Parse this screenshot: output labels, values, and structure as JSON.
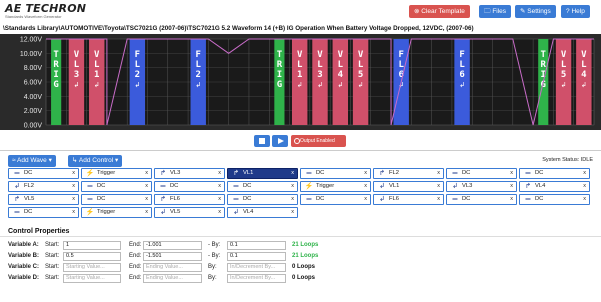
{
  "logo": {
    "main": "AE TECHRON",
    "sub": "Standards Waveform Generator"
  },
  "toolbar": {
    "clear_label": "Clear Template",
    "files_label": "Files",
    "settings_label": "Settings",
    "help_label": "Help"
  },
  "path": "\\Standards Library\\AUTOMOTIVE\\Toyota\\TSC7021G (2007-06)\\TSC7021G 5.2 Waveform 14 (+B) IG Operation When Battery Voltage Dropped, 12VDC, (2007-06)",
  "chart_data": {
    "type": "line",
    "y_ticks": [
      "12.00V",
      "10.00V",
      "8.00V",
      "6.00V",
      "4.00V",
      "2.00V",
      "0.00V"
    ],
    "ylim": [
      0,
      12
    ],
    "background": "#2a2a2a",
    "segments": [
      {
        "label": "TRIG",
        "kind": "trigger",
        "color": "#2fb34a"
      },
      {
        "label": "VL3",
        "kind": "vl",
        "color": "#d0506a"
      },
      {
        "label": "VL1",
        "kind": "vl",
        "color": "#d0506a"
      },
      {
        "label": "",
        "kind": "dc",
        "color": ""
      },
      {
        "label": "FL2",
        "kind": "fl",
        "color": "#3b5bdb"
      },
      {
        "label": "",
        "kind": "dc",
        "color": ""
      },
      {
        "label": "",
        "kind": "dc",
        "color": ""
      },
      {
        "label": "FL2",
        "kind": "fl",
        "color": "#3b5bdb"
      },
      {
        "label": "",
        "kind": "dc",
        "color": ""
      },
      {
        "label": "",
        "kind": "dc",
        "color": ""
      },
      {
        "label": "",
        "kind": "dc",
        "color": ""
      },
      {
        "label": "TRIG",
        "kind": "trigger",
        "color": "#2fb34a"
      },
      {
        "label": "VL1",
        "kind": "vl",
        "color": "#d0506a"
      },
      {
        "label": "VL3",
        "kind": "vl",
        "color": "#d0506a"
      },
      {
        "label": "VL4",
        "kind": "vl",
        "color": "#d0506a"
      },
      {
        "label": "VL5",
        "kind": "vl",
        "color": "#d0506a"
      },
      {
        "label": "",
        "kind": "dc",
        "color": ""
      },
      {
        "label": "FL6",
        "kind": "fl",
        "color": "#3b5bdb"
      },
      {
        "label": "",
        "kind": "dc",
        "color": ""
      },
      {
        "label": "",
        "kind": "dc",
        "color": ""
      },
      {
        "label": "FL6",
        "kind": "fl",
        "color": "#3b5bdb"
      },
      {
        "label": "",
        "kind": "dc",
        "color": ""
      },
      {
        "label": "",
        "kind": "dc",
        "color": ""
      },
      {
        "label": "",
        "kind": "dc",
        "color": ""
      },
      {
        "label": "TRIG",
        "kind": "trigger",
        "color": "#2fb34a"
      },
      {
        "label": "VL5",
        "kind": "vl",
        "color": "#d0506a"
      },
      {
        "label": "VL4",
        "kind": "vl",
        "color": "#d0506a"
      }
    ]
  },
  "transport": {
    "output_label": "Output Enabled"
  },
  "controls": {
    "add_wave_label": "Add Wave",
    "add_control_label": "Add Control",
    "status_label": "System Status:",
    "status_value": "IDLE"
  },
  "tiles": [
    {
      "label": "DC",
      "icon": "dc-icon",
      "selected": false
    },
    {
      "label": "Trigger",
      "icon": "trigger-icon",
      "selected": false
    },
    {
      "label": "VL3",
      "icon": "loop-icon",
      "selected": false
    },
    {
      "label": "VL1",
      "icon": "loop-icon",
      "selected": true
    },
    {
      "label": "DC",
      "icon": "dc-icon",
      "selected": false
    },
    {
      "label": "FL2",
      "icon": "loop-icon",
      "selected": false
    },
    {
      "label": "DC",
      "icon": "dc-icon",
      "selected": false
    },
    {
      "label": "DC",
      "icon": "dc-icon",
      "selected": false
    },
    {
      "label": "FL2",
      "icon": "loop-end-icon",
      "selected": false
    },
    {
      "label": "DC",
      "icon": "dc-icon",
      "selected": false
    },
    {
      "label": "DC",
      "icon": "dc-icon",
      "selected": false
    },
    {
      "label": "DC",
      "icon": "dc-icon",
      "selected": false
    },
    {
      "label": "Trigger",
      "icon": "trigger-icon",
      "selected": false
    },
    {
      "label": "VL1",
      "icon": "loop-end-icon",
      "selected": false
    },
    {
      "label": "VL3",
      "icon": "loop-end-icon",
      "selected": false
    },
    {
      "label": "VL4",
      "icon": "loop-icon",
      "selected": false
    },
    {
      "label": "VL5",
      "icon": "loop-icon",
      "selected": false
    },
    {
      "label": "DC",
      "icon": "dc-icon",
      "selected": false
    },
    {
      "label": "FL6",
      "icon": "loop-icon",
      "selected": false
    },
    {
      "label": "DC",
      "icon": "dc-icon",
      "selected": false
    },
    {
      "label": "DC",
      "icon": "dc-icon",
      "selected": false
    },
    {
      "label": "FL6",
      "icon": "loop-end-icon",
      "selected": false
    },
    {
      "label": "DC",
      "icon": "dc-icon",
      "selected": false
    },
    {
      "label": "DC",
      "icon": "dc-icon",
      "selected": false
    },
    {
      "label": "DC",
      "icon": "dc-icon",
      "selected": false
    },
    {
      "label": "Trigger",
      "icon": "trigger-icon",
      "selected": false
    },
    {
      "label": "VL5",
      "icon": "loop-end-icon",
      "selected": false
    },
    {
      "label": "VL4",
      "icon": "loop-end-icon",
      "selected": false
    }
  ],
  "control_properties": {
    "title": "Control Properties",
    "rows": [
      {
        "label": "Variable A:",
        "start_label": "Start:",
        "start_value": "1",
        "start_placeholder": "Starting Value...",
        "end_label": "End:",
        "end_value": "-1.001",
        "end_placeholder": "Ending Value...",
        "by_label": "- By:",
        "by_value": "0.1",
        "by_placeholder": "In/Decrement By...",
        "loops": "21 Loops",
        "loops_color": "#2fb34a"
      },
      {
        "label": "Variable B:",
        "start_label": "Start:",
        "start_value": "0.5",
        "start_placeholder": "Starting Value...",
        "end_label": "End:",
        "end_value": "-1.501",
        "end_placeholder": "Ending Value...",
        "by_label": "- By:",
        "by_value": "0.1",
        "by_placeholder": "In/Decrement By...",
        "loops": "21 Loops",
        "loops_color": "#2fb34a"
      },
      {
        "label": "Variable C:",
        "start_label": "Start:",
        "start_value": "",
        "start_placeholder": "Starting Value...",
        "end_label": "End:",
        "end_value": "",
        "end_placeholder": "Ending Value...",
        "by_label": "By:",
        "by_value": "",
        "by_placeholder": "In/Decrement By...",
        "loops": "0 Loops",
        "loops_color": "#111111"
      },
      {
        "label": "Variable D:",
        "start_label": "Start:",
        "start_value": "",
        "start_placeholder": "Starting Value...",
        "end_label": "End:",
        "end_value": "",
        "end_placeholder": "Ending Value...",
        "by_label": "By:",
        "by_value": "",
        "by_placeholder": "In/Decrement By...",
        "loops": "0 Loops",
        "loops_color": "#111111"
      }
    ]
  }
}
